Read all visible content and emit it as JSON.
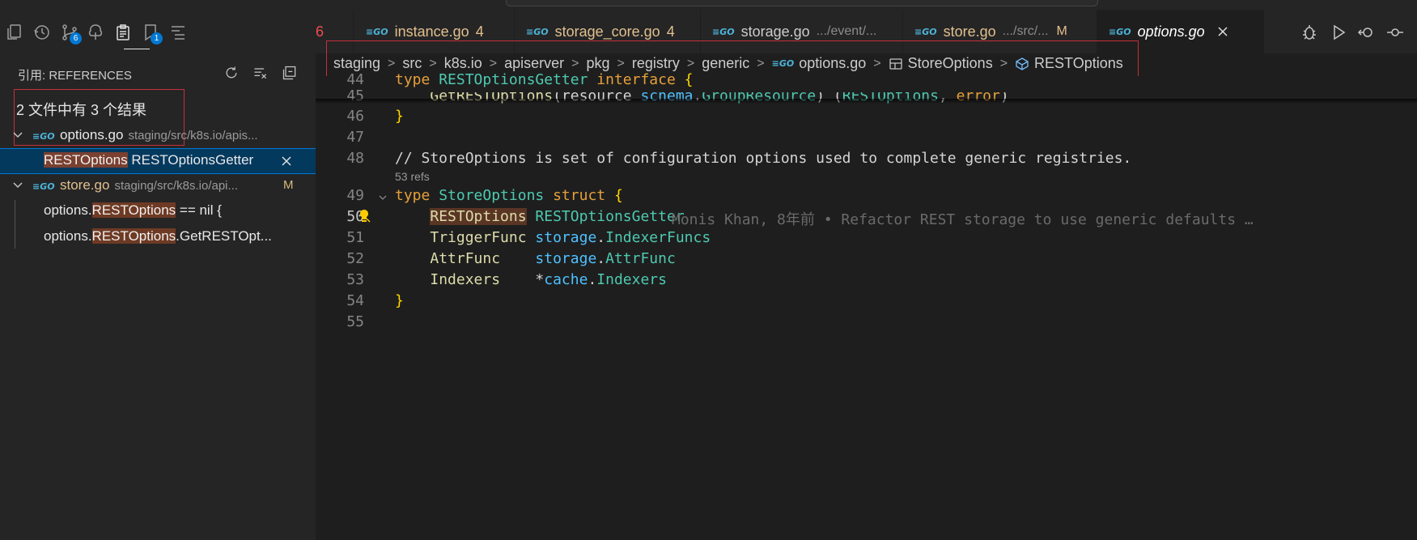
{
  "activity_bar": {
    "source_control_badge": "6",
    "bookmarks_badge": "1"
  },
  "references_panel": {
    "title": "引用: REFERENCES",
    "summary": "2 文件中有 3 个结果",
    "files": [
      {
        "name": "options.go",
        "path": "staging/src/k8s.io/apis...",
        "modified": "",
        "matches": [
          {
            "pre": "",
            "hit": "RESTOptions",
            "post": " RESTOptionsGetter"
          }
        ]
      },
      {
        "name": "store.go",
        "path": "staging/src/k8s.io/api...",
        "modified": "M",
        "matches": [
          {
            "pre": "options.",
            "hit": "RESTOptions",
            "post": " == nil {"
          },
          {
            "pre": "options.",
            "hit": "RESTOptions",
            "post": ".GetRESTOpt..."
          }
        ]
      }
    ]
  },
  "tabs": [
    {
      "label": "6",
      "count": "",
      "path": "",
      "modified": ""
    },
    {
      "label": "instance.go",
      "count": "4",
      "path": "",
      "modified": ""
    },
    {
      "label": "storage_core.go",
      "count": "4",
      "path": "",
      "modified": ""
    },
    {
      "label": "storage.go",
      "count": "",
      "path": ".../event/...",
      "modified": ""
    },
    {
      "label": "store.go",
      "count": "",
      "path": ".../src/...",
      "modified": "M"
    },
    {
      "label": "options.go",
      "count": "",
      "path": "",
      "modified": ""
    }
  ],
  "breadcrumb": [
    "staging",
    "src",
    "k8s.io",
    "apiserver",
    "pkg",
    "registry",
    "generic",
    "options.go",
    "StoreOptions",
    "RESTOptions"
  ],
  "editor": {
    "line_numbers": [
      "44",
      "45",
      "46",
      "47",
      "48",
      "49",
      "50",
      "51",
      "52",
      "53",
      "54",
      "55"
    ],
    "code": {
      "l44_kw": "type",
      "l44_name": "RESTOptionsGetter",
      "l44_kw2": "interface",
      "l44_brace": "{",
      "l45_fn": "GetRESTOptions",
      "l45_param": "resource",
      "l45_pkg": "schema",
      "l45_type": "GroupResource",
      "l45_ret": "RESTOptions",
      "l45_err": "error",
      "l46": "}",
      "l48": "// StoreOptions is set of configuration options used to complete generic registries.",
      "refs": "53 refs",
      "l49_kw": "type",
      "l49_name": "StoreOptions",
      "l49_kw2": "struct",
      "l49_brace": "{",
      "l50_field": "RESTOptions",
      "l50_type": "RESTOptionsGetter",
      "l51_field": "TriggerFunc",
      "l51_pkg": "storage",
      "l51_type": "IndexerFuncs",
      "l52_field": "AttrFunc",
      "l52_pkg": "storage",
      "l52_type": "AttrFunc",
      "l53_field": "Indexers",
      "l53_pkg": "cache",
      "l53_type": "Indexers",
      "l54": "}"
    },
    "blame": "Monis Khan, 8年前 • Refactor REST storage to use generic defaults …"
  },
  "colors": {
    "accent": "#0078d4",
    "highlight_box": "#c5303a",
    "match_highlight": "#6e3a24"
  }
}
